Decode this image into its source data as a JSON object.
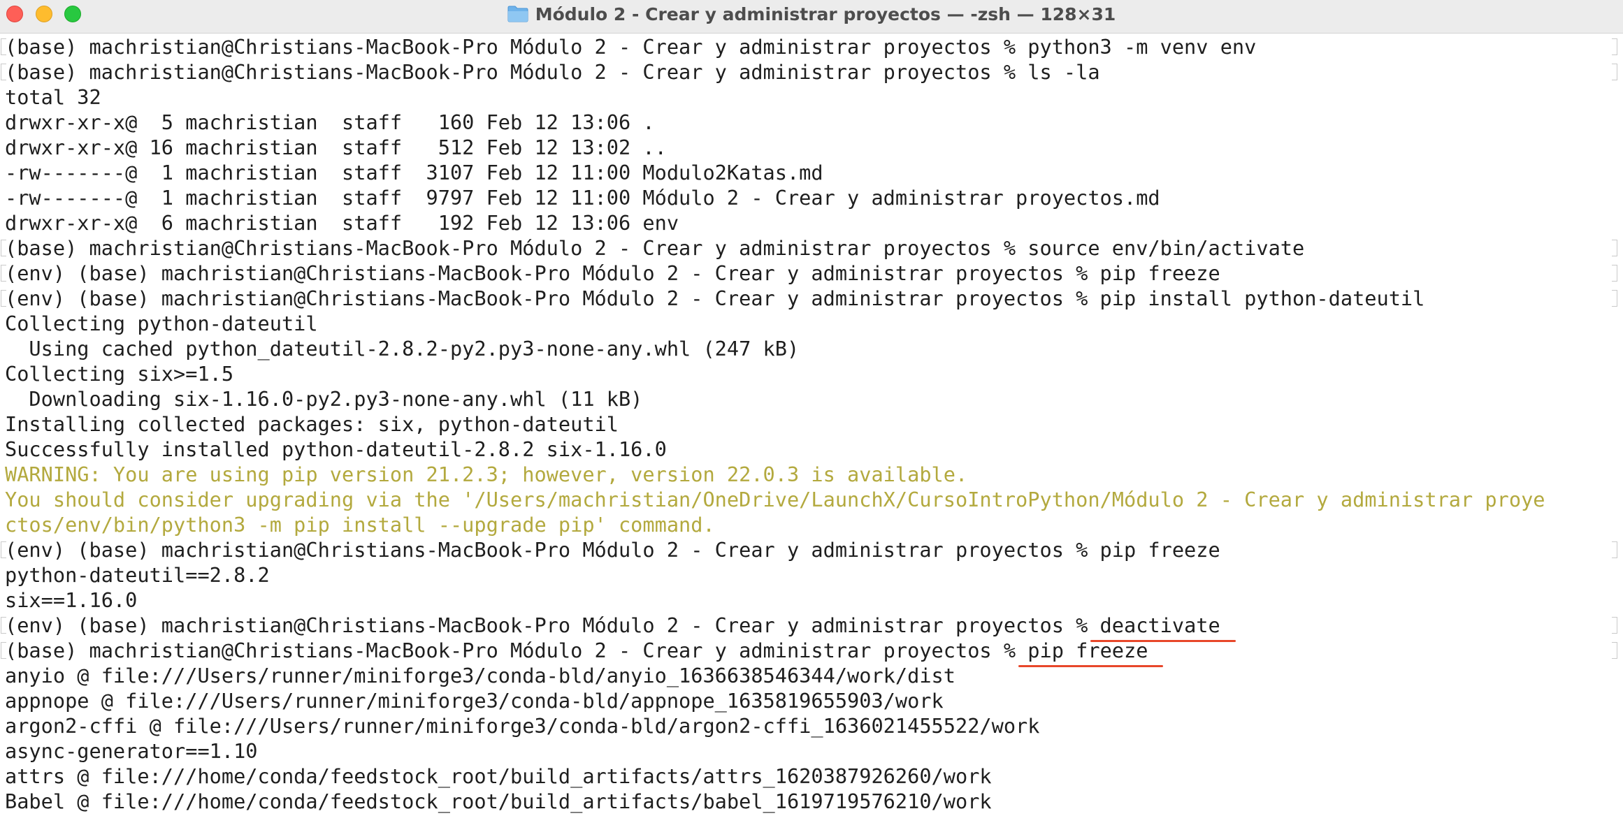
{
  "window": {
    "title": "Módulo 2 - Crear y administrar proyectos — -zsh — 128×31",
    "icon": "folder-icon"
  },
  "terminal": {
    "lines": [
      {
        "text": "(base) machristian@Christians-MacBook-Pro Módulo 2 - Crear y administrar proyectos % python3 -m venv env",
        "kind": "prompt"
      },
      {
        "text": "(base) machristian@Christians-MacBook-Pro Módulo 2 - Crear y administrar proyectos % ls -la",
        "kind": "prompt"
      },
      {
        "text": "total 32",
        "kind": "output"
      },
      {
        "text": "drwxr-xr-x@  5 machristian  staff   160 Feb 12 13:06 .",
        "kind": "output"
      },
      {
        "text": "drwxr-xr-x@ 16 machristian  staff   512 Feb 12 13:02 ..",
        "kind": "output"
      },
      {
        "text": "-rw-------@  1 machristian  staff  3107 Feb 12 11:00 Modulo2Katas.md",
        "kind": "output"
      },
      {
        "text": "-rw-------@  1 machristian  staff  9797 Feb 12 11:00 Módulo 2 - Crear y administrar proyectos.md",
        "kind": "output"
      },
      {
        "text": "drwxr-xr-x@  6 machristian  staff   192 Feb 12 13:06 env",
        "kind": "output"
      },
      {
        "text": "(base) machristian@Christians-MacBook-Pro Módulo 2 - Crear y administrar proyectos % source env/bin/activate",
        "kind": "prompt"
      },
      {
        "text": "(env) (base) machristian@Christians-MacBook-Pro Módulo 2 - Crear y administrar proyectos % pip freeze",
        "kind": "prompt"
      },
      {
        "text": "(env) (base) machristian@Christians-MacBook-Pro Módulo 2 - Crear y administrar proyectos % pip install python-dateutil",
        "kind": "prompt"
      },
      {
        "text": "Collecting python-dateutil",
        "kind": "output"
      },
      {
        "text": "  Using cached python_dateutil-2.8.2-py2.py3-none-any.whl (247 kB)",
        "kind": "output"
      },
      {
        "text": "Collecting six>=1.5",
        "kind": "output"
      },
      {
        "text": "  Downloading six-1.16.0-py2.py3-none-any.whl (11 kB)",
        "kind": "output"
      },
      {
        "text": "Installing collected packages: six, python-dateutil",
        "kind": "output"
      },
      {
        "text": "Successfully installed python-dateutil-2.8.2 six-1.16.0",
        "kind": "output"
      },
      {
        "text": "WARNING: You are using pip version 21.2.3; however, version 22.0.3 is available.",
        "kind": "warning"
      },
      {
        "text": "You should consider upgrading via the '/Users/machristian/OneDrive/LaunchX/CursoIntroPython/Módulo 2 - Crear y administrar proye",
        "kind": "warning"
      },
      {
        "text": "ctos/env/bin/python3 -m pip install --upgrade pip' command.",
        "kind": "warning"
      },
      {
        "text": "(env) (base) machristian@Christians-MacBook-Pro Módulo 2 - Crear y administrar proyectos % pip freeze",
        "kind": "prompt"
      },
      {
        "text": "python-dateutil==2.8.2",
        "kind": "output"
      },
      {
        "text": "six==1.16.0",
        "kind": "output"
      },
      {
        "prefix": "(env) (base) machristian@Christians-MacBook-Pro Módulo 2 - Crear y administrar proyectos %",
        "command": " deactivate",
        "kind": "prompt-marked"
      },
      {
        "prefix": "(base) machristian@Christians-MacBook-Pro Módulo 2 - Crear y administrar proyectos %",
        "command": " pip freeze",
        "kind": "prompt-marked"
      },
      {
        "text": "anyio @ file:///Users/runner/miniforge3/conda-bld/anyio_1636638546344/work/dist",
        "kind": "output"
      },
      {
        "text": "appnope @ file:///Users/runner/miniforge3/conda-bld/appnope_1635819655903/work",
        "kind": "output"
      },
      {
        "text": "argon2-cffi @ file:///Users/runner/miniforge3/conda-bld/argon2-cffi_1636021455522/work",
        "kind": "output"
      },
      {
        "text": "async-generator==1.10",
        "kind": "output"
      },
      {
        "text": "attrs @ file:///home/conda/feedstock_root/build_artifacts/attrs_1620387926260/work",
        "kind": "output"
      },
      {
        "text": "Babel @ file:///home/conda/feedstock_root/build_artifacts/babel_1619719576210/work",
        "kind": "output"
      }
    ]
  },
  "colors": {
    "warning_text": "#b3a93e",
    "annotation_underline": "#e8472a",
    "text": "#1e1e1e"
  }
}
